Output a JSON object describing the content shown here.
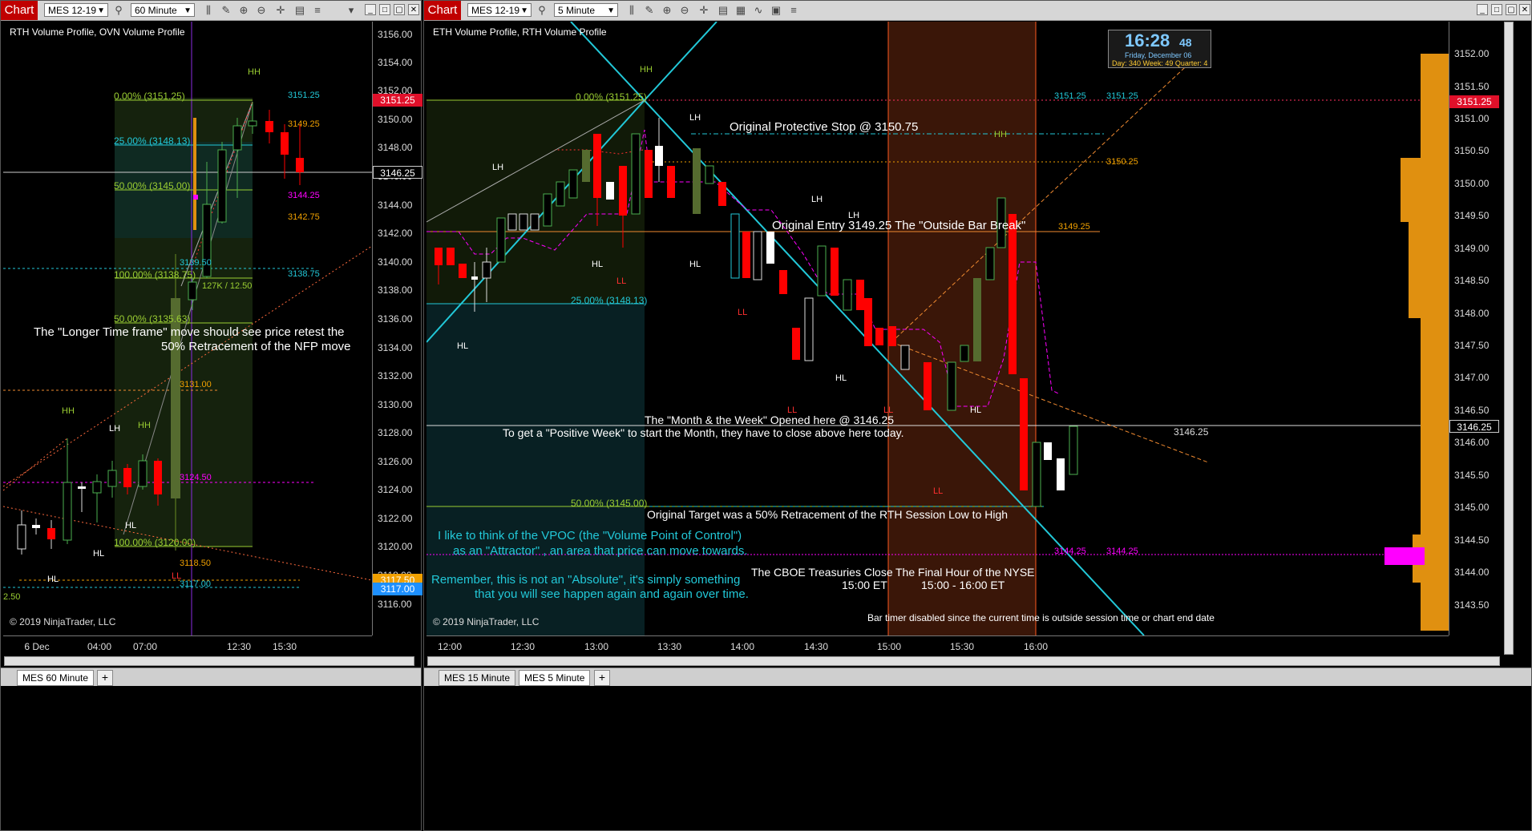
{
  "left": {
    "toolbar": {
      "chart_label": "Chart",
      "instrument": "MES 12-19",
      "interval": "60 Minute"
    },
    "indicators": "RTH Volume Profile, OVN Volume Profile",
    "copyright": "© 2019 NinjaTrader, LLC",
    "y_ticks": [
      "3156.00",
      "3154.00",
      "3152.00",
      "3150.00",
      "3148.00",
      "3146.00",
      "3144.00",
      "3142.00",
      "3140.00",
      "3138.00",
      "3136.00",
      "3134.00",
      "3132.00",
      "3130.00",
      "3128.00",
      "3126.00",
      "3124.00",
      "3122.00",
      "3120.00",
      "3118.00",
      "3116.00"
    ],
    "x_ticks": [
      "6 Dec",
      "04:00",
      "07:00",
      "12:30",
      "15:30"
    ],
    "price_tags": {
      "last": "3151.25",
      "open": "3146.25",
      "tag1": "3117.50",
      "tag2": "3117.00"
    },
    "fib": [
      "0.00% (3151.25)",
      "25.00% (3148.13)",
      "50.00% (3145.00)",
      "100.00% (3138.75)",
      "50.00% (3135.63)",
      "100.00% (3120.00)"
    ],
    "levels": [
      "3151.25",
      "3149.25",
      "3144.25",
      "3142.75",
      "3138.75",
      "3139.50",
      "3131.00",
      "3124.50",
      "3118.50",
      "3117.00"
    ],
    "misc": {
      "vol": "127K / 12.50",
      "small": "2.50"
    },
    "swing": [
      "HH",
      "LH",
      "HH",
      "LH",
      "HL",
      "HL",
      "HL",
      "LL"
    ],
    "annotation": [
      "The \"Longer Time frame\" move should see price retest the",
      "50% Retracement of the NFP move"
    ],
    "tabs": [
      "MES  60 Minute"
    ]
  },
  "right": {
    "toolbar": {
      "chart_label": "Chart",
      "instrument": "MES 12-19",
      "interval": "5 Minute"
    },
    "indicators": "ETH Volume Profile, RTH Volume Profile",
    "copyright": "© 2019 NinjaTrader, LLC",
    "bar_timer": "Bar timer disabled since the current time is outside session time or chart end date",
    "y_ticks": [
      "3152.00",
      "3151.50",
      "3151.00",
      "3150.50",
      "3150.00",
      "3149.50",
      "3149.00",
      "3148.50",
      "3148.00",
      "3147.50",
      "3147.00",
      "3146.50",
      "3146.00",
      "3145.50",
      "3145.00",
      "3144.50",
      "3144.00",
      "3143.50"
    ],
    "x_ticks": [
      "12:00",
      "12:30",
      "13:00",
      "13:30",
      "14:00",
      "14:30",
      "15:00",
      "15:30",
      "16:00"
    ],
    "price_tags": {
      "last": "3151.25",
      "open": "3146.25"
    },
    "clock": {
      "time": "16:28",
      "seconds": "48",
      "date": "Friday, December 06",
      "week": "Day: 340  Week: 49  Quarter: 4"
    },
    "fib": [
      "0.00% (3151.25)",
      "25.00% (3148.13)",
      "50.00% (3145.00)"
    ],
    "levels": [
      "3151.25",
      "3151.25",
      "3150.25",
      "3149.25",
      "3144.25",
      "3144.25",
      "3146.25"
    ],
    "swing": [
      "HH",
      "LH",
      "LH",
      "LH",
      "LH",
      "HL",
      "HL",
      "HL",
      "HL",
      "HL",
      "HH",
      "LL",
      "LL",
      "LL",
      "LL",
      "LL",
      "HH"
    ],
    "notes": {
      "stop": "Original Protective Stop @ 3150.75",
      "entry": "Original Entry 3149.25 The \"Outside Bar Break\"",
      "month1": "The \"Month & the Week\" Opened here @ 3146.25",
      "month2": "To get a \"Positive Week\" to start the Month, they have to close above here today.",
      "target": "Original Target was a 50% Retracement of the RTH Session Low to High",
      "vpoc1": "I like to think of the VPOC (the \"Volume Point of Control\")",
      "vpoc2": "as an \"Attractor\" , an area that price can move towards.",
      "rem1": "Remember, this is not an \"Absolute\", it's simply something",
      "rem2": "that you will see happen again and again over time.",
      "cboe1": "The CBOE Treasuries Close",
      "cboe2": "15:00 ET",
      "nyse1": "The Final Hour of the NYSE",
      "nyse2": "15:00 - 16:00 ET"
    },
    "tabs": [
      "MES  15 Minute",
      "MES  5 Minute"
    ]
  },
  "colors": {
    "bull": "#4caf50",
    "bear": "#ff0000",
    "cyan": "#22c8d8",
    "orange": "#f08a30",
    "magenta": "#ff00ff",
    "fib": "#9acd32",
    "profile": "#e09010"
  }
}
